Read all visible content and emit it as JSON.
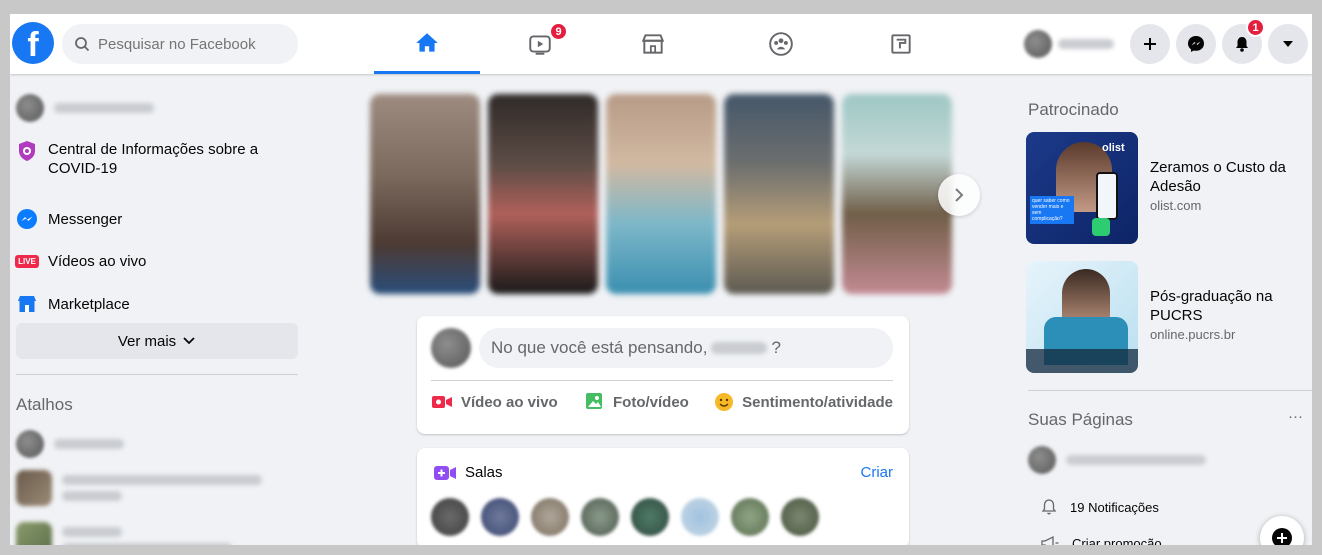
{
  "search": {
    "placeholder": "Pesquisar no Facebook"
  },
  "topbar": {
    "watch_badge": "9",
    "notifications_badge": "1",
    "icons": [
      "home-icon",
      "watch-icon",
      "marketplace-icon",
      "groups-icon",
      "gaming-icon",
      "plus-icon",
      "messenger-icon",
      "bell-icon",
      "caret-down-icon"
    ]
  },
  "sidebar": {
    "items": [
      {
        "label": "Central de Informações sobre a COVID-19",
        "icon": "covid-shield-icon"
      },
      {
        "label": "Messenger",
        "icon": "messenger-icon"
      },
      {
        "label": "Vídeos ao vivo",
        "icon": "live-icon",
        "badge": "LIVE"
      },
      {
        "label": "Marketplace",
        "icon": "shop-icon"
      }
    ],
    "see_more": "Ver mais",
    "shortcuts_title": "Atalhos"
  },
  "composer": {
    "prompt_prefix": "No que você está pensando,",
    "prompt_suffix": "?",
    "actions": [
      {
        "label": "Vídeo ao vivo",
        "color": "#f02849"
      },
      {
        "label": "Foto/vídeo",
        "color": "#45bd62"
      },
      {
        "label": "Sentimento/atividade",
        "color": "#f7b928"
      }
    ]
  },
  "rooms": {
    "title": "Salas",
    "create": "Criar"
  },
  "sponsored": {
    "title": "Patrocinado",
    "ads": [
      {
        "title": "Zeramos o Custo da Adesão",
        "url": "olist.com",
        "image_text": "olist",
        "image_sub": "quer saber como vender mais e sem complicação?"
      },
      {
        "title": "Pós-graduação na PUCRS",
        "url": "online.pucrs.br"
      }
    ]
  },
  "pages": {
    "title": "Suas Páginas",
    "more": "···",
    "notifications": "19 Notificações",
    "promote": "Criar promoção"
  },
  "colors": {
    "brand": "#1877f2",
    "badge": "#e41e3f",
    "background": "#f0f2f5"
  }
}
